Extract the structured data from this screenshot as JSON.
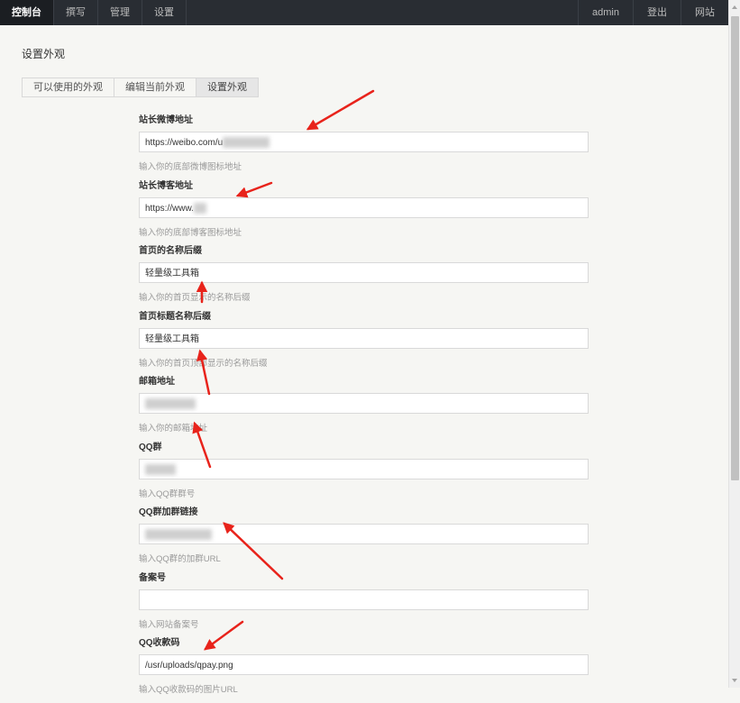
{
  "topbar": {
    "nav": [
      "控制台",
      "撰写",
      "管理",
      "设置"
    ],
    "user": "admin",
    "logout": "登出",
    "site": "网站"
  },
  "page_title": "设置外观",
  "tabs": [
    "可以使用的外观",
    "编辑当前外观",
    "设置外观"
  ],
  "fields": [
    {
      "label": "站长微博地址",
      "value": "https://weibo.com/u",
      "help": "输入你的底部微博图标地址"
    },
    {
      "label": "站长博客地址",
      "value": "https://www.",
      "help": "输入你的底部博客图标地址"
    },
    {
      "label": "首页的名称后缀",
      "value": "轻量级工具箱",
      "help": "输入你的首页显示的名称后缀"
    },
    {
      "label": "首页标题名称后缀",
      "value": "轻量级工具箱",
      "help": "输入你的首页顶部显示的名称后缀"
    },
    {
      "label": "邮箱地址",
      "value": "",
      "help": "输入你的邮箱地址"
    },
    {
      "label": "QQ群",
      "value": "",
      "help": "输入QQ群群号"
    },
    {
      "label": "QQ群加群链接",
      "value": "",
      "help": "输入QQ群的加群URL"
    },
    {
      "label": "备案号",
      "value": "",
      "help": "输入网站备案号"
    },
    {
      "label": "QQ收款码",
      "value": "/usr/uploads/qpay.png",
      "help": "输入QQ收款码的图片URL"
    }
  ],
  "colors": {
    "topbar": "#292d33",
    "arrow": "#e8231b",
    "background": "#f6f6f3"
  }
}
